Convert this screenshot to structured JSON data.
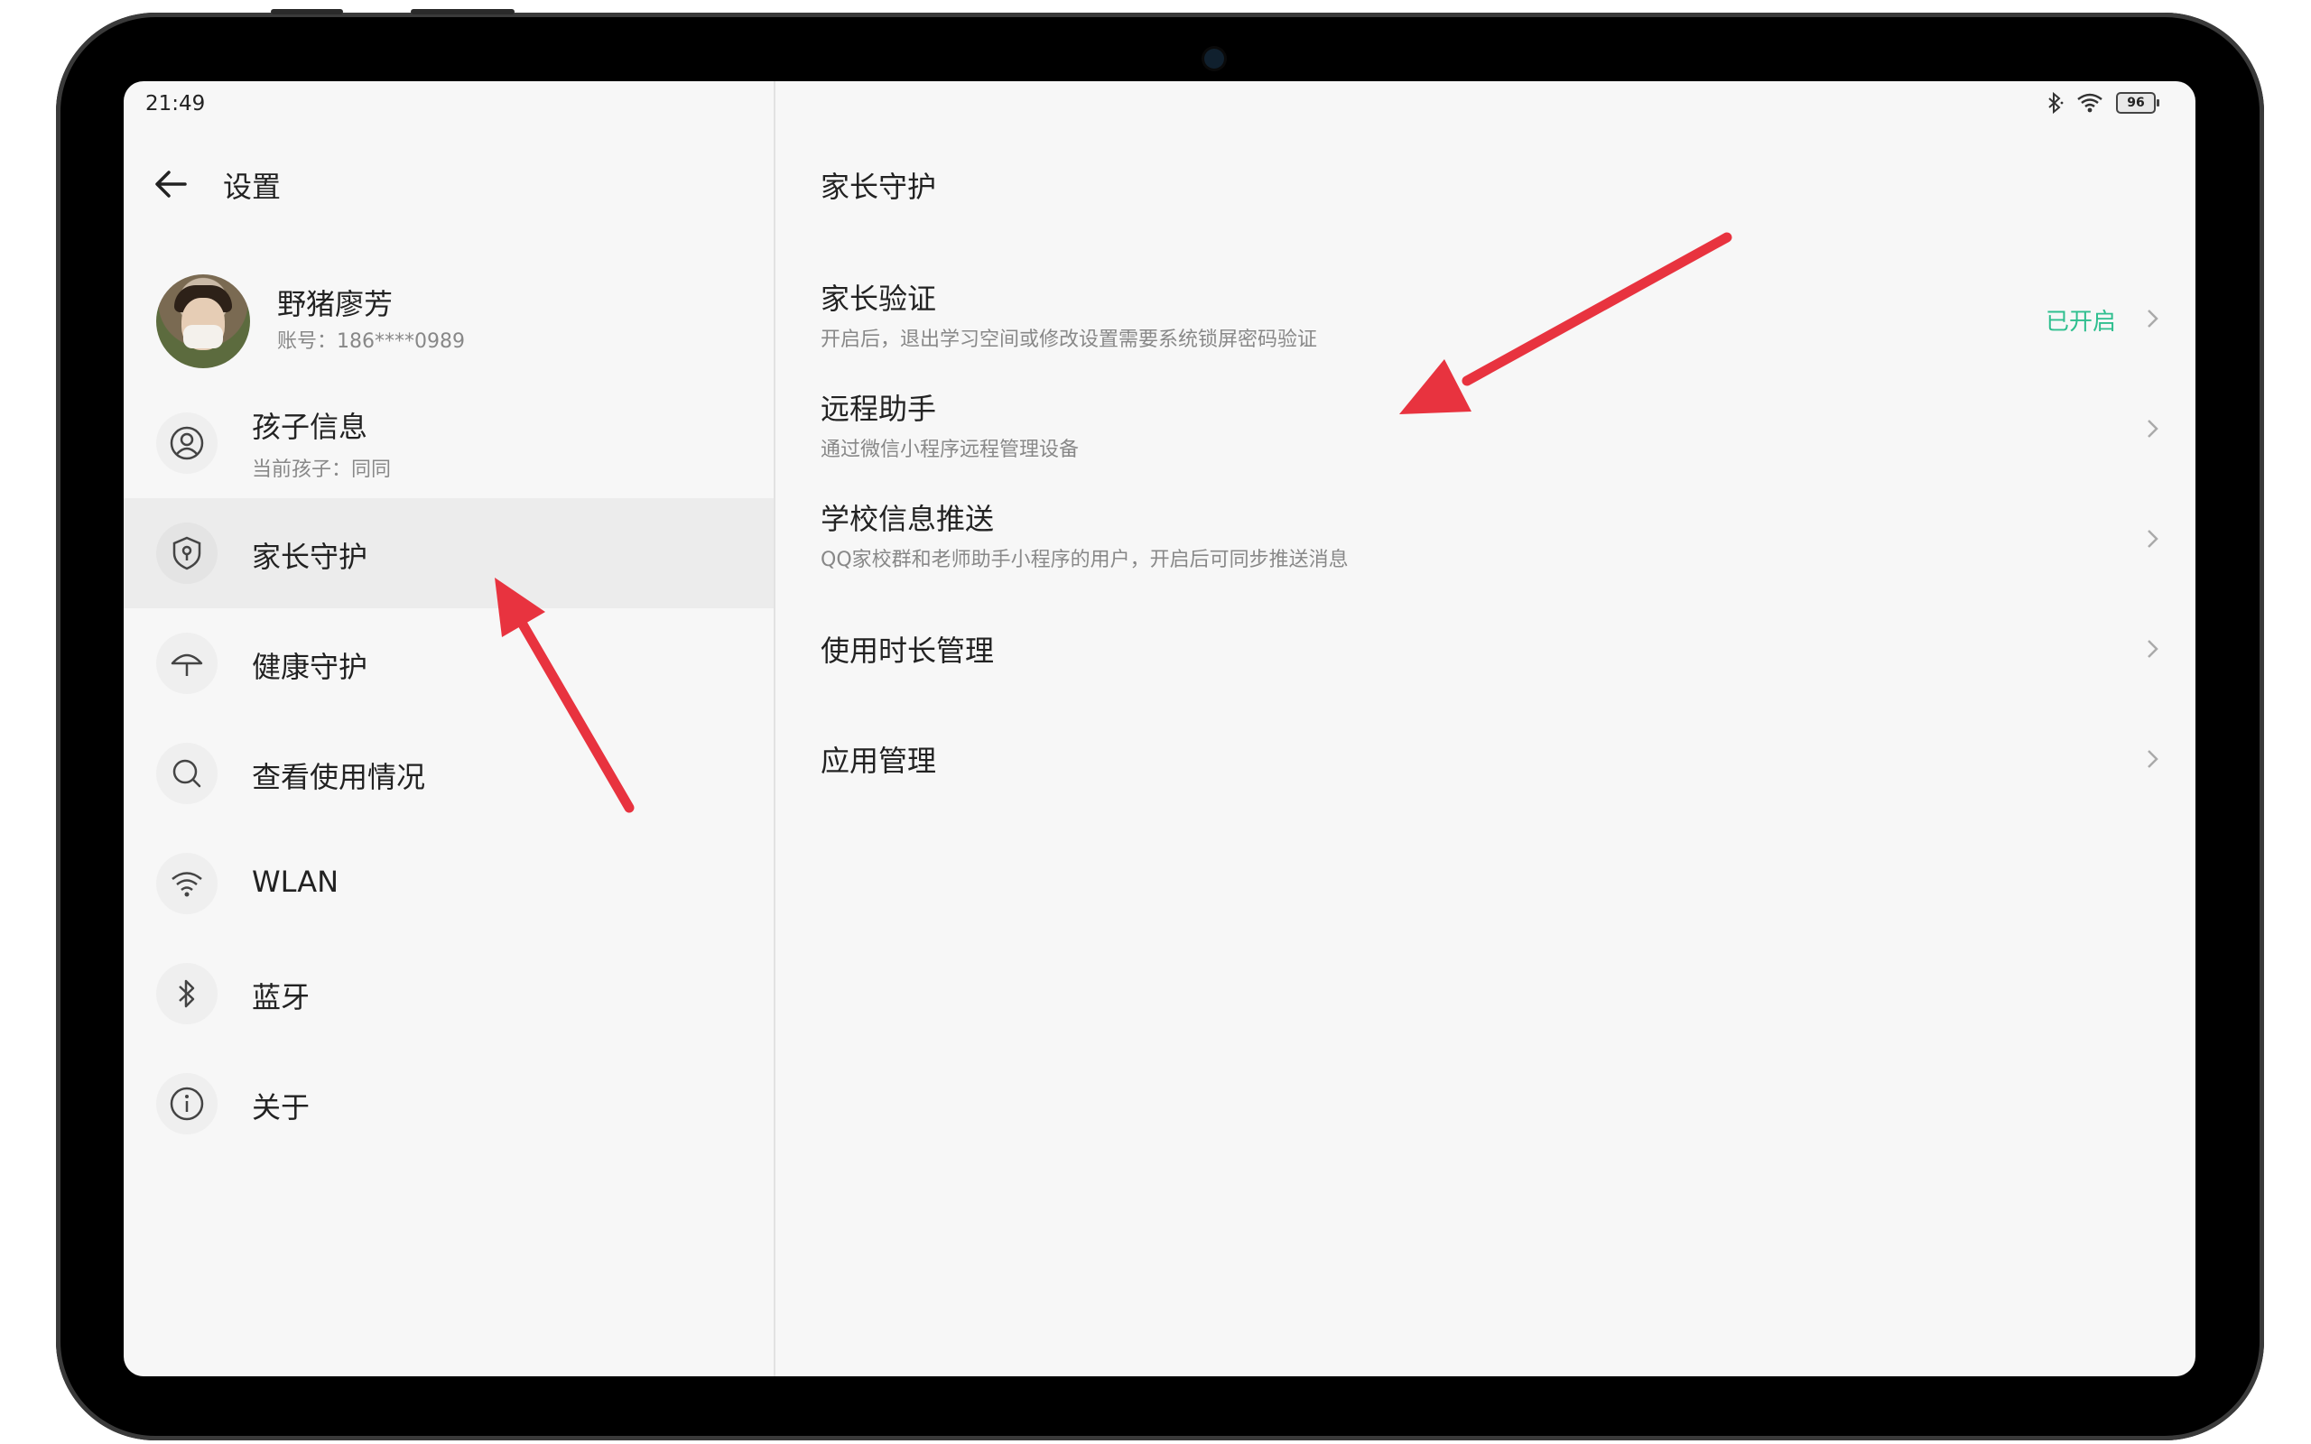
{
  "status_bar": {
    "time": "21:49",
    "battery": "96"
  },
  "left_panel": {
    "title": "设置",
    "profile": {
      "name": "野猪廖芳",
      "account": "账号：186****0989"
    },
    "items": [
      {
        "label": "孩子信息",
        "sub": "当前孩子：同同",
        "icon": "person-icon"
      },
      {
        "label": "家长守护",
        "icon": "shield-icon",
        "selected": true
      },
      {
        "label": "健康守护",
        "icon": "umbrella-icon"
      },
      {
        "label": "查看使用情况",
        "icon": "search-icon"
      },
      {
        "label": "WLAN",
        "icon": "wifi-icon"
      },
      {
        "label": "蓝牙",
        "icon": "bluetooth-icon"
      },
      {
        "label": "关于",
        "icon": "info-icon"
      }
    ]
  },
  "right_panel": {
    "title": "家长守护",
    "rows": [
      {
        "title": "家长验证",
        "sub": "开启后，退出学习空间或修改设置需要系统锁屏密码验证",
        "status": "已开启"
      },
      {
        "title": "远程助手",
        "sub": "通过微信小程序远程管理设备"
      },
      {
        "title": "学校信息推送",
        "sub": "QQ家校群和老师助手小程序的用户，开启后可同步推送消息"
      },
      {
        "title": "使用时长管理"
      },
      {
        "title": "应用管理"
      }
    ]
  },
  "colors": {
    "accent_green": "#2fbf8f",
    "annotation_red": "#e8333f"
  }
}
